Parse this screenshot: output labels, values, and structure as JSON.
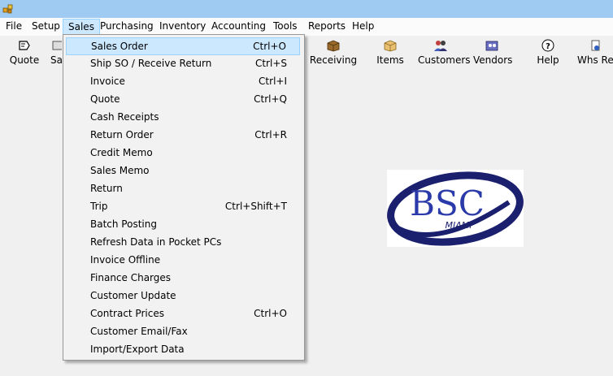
{
  "window": {
    "icon": "app-icon"
  },
  "menubar": {
    "items": [
      "File",
      "Setup",
      "Sales",
      "Purchasing",
      "Inventory",
      "Accounting",
      "Tools",
      "Reports",
      "Help"
    ],
    "active": "Sales"
  },
  "toolbar": {
    "items": [
      {
        "label": "Quote",
        "icon": "quote-icon"
      },
      {
        "label": "Sa",
        "icon": "sales-icon"
      },
      {
        "label": "Receiving",
        "icon": "receiving-box-icon"
      },
      {
        "label": "Items",
        "icon": "items-box-icon"
      },
      {
        "label": "Customers",
        "icon": "customers-people-icon"
      },
      {
        "label": "Vendors",
        "icon": "vendors-icon"
      },
      {
        "label": "Help",
        "icon": "help-question-icon"
      },
      {
        "label": "Whs Re",
        "icon": "warehouse-receipt-icon"
      }
    ]
  },
  "sales_menu": {
    "items": [
      {
        "label": "Sales Order",
        "shortcut": "Ctrl+O",
        "highlighted": true
      },
      {
        "label": "Ship SO / Receive Return",
        "shortcut": "Ctrl+S"
      },
      {
        "label": "Invoice",
        "shortcut": "Ctrl+I"
      },
      {
        "label": "Quote",
        "shortcut": "Ctrl+Q"
      },
      {
        "label": "Cash Receipts",
        "shortcut": ""
      },
      {
        "label": "Return Order",
        "shortcut": "Ctrl+R"
      },
      {
        "label": "Credit Memo",
        "shortcut": ""
      },
      {
        "label": "Sales Memo",
        "shortcut": ""
      },
      {
        "label": "Return",
        "shortcut": ""
      },
      {
        "label": "Trip",
        "shortcut": "Ctrl+Shift+T"
      },
      {
        "label": "Batch Posting",
        "shortcut": ""
      },
      {
        "label": "Refresh Data in Pocket PCs",
        "shortcut": ""
      },
      {
        "label": "Invoice Offline",
        "shortcut": ""
      },
      {
        "label": "Finance Charges",
        "shortcut": ""
      },
      {
        "label": "Customer Update",
        "shortcut": ""
      },
      {
        "label": "Contract Prices",
        "shortcut": "Ctrl+O"
      },
      {
        "label": "Customer Email/Fax",
        "shortcut": ""
      },
      {
        "label": "Import/Export Data",
        "shortcut": ""
      }
    ]
  },
  "logo": {
    "text": "BSC",
    "subtext": "MIAMI",
    "color": "#1a1f6e"
  }
}
